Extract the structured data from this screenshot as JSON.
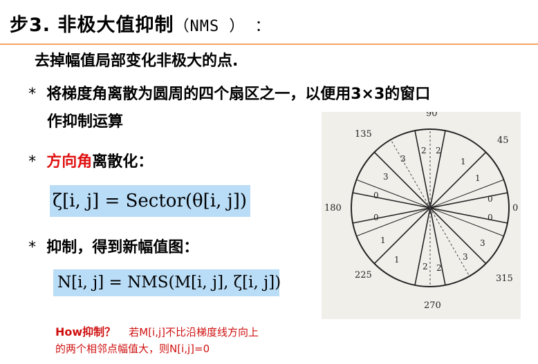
{
  "title": {
    "prefix": "步3. 非极大值抑制",
    "suffix": "（NMS ） ："
  },
  "intro": "去掉幅值局部变化非极大的点.",
  "bullets": {
    "b1_line1": "将梯度角离散为圆周的四个扇区之一，以便用3×3的窗口",
    "b1_line2": "作抑制运算",
    "b2_red": "方向角",
    "b2_rest": "离散化：",
    "b3": "抑制，得到新幅值图："
  },
  "star": "*",
  "formulas": {
    "sector": "ζ[i, j] = Sector(θ[i, j])",
    "nms": "N[i, j] = NMS(M[i, j], ζ[i, j])"
  },
  "diagram": {
    "angles": {
      "a90": "90",
      "a45": "45",
      "a135": "135",
      "a0": "0",
      "a180": "180",
      "a225": "225",
      "a270": "270",
      "a315": "315"
    },
    "sector_labels": [
      "2",
      "2",
      "1",
      "3",
      "3",
      "1",
      "0",
      "0",
      "0",
      "0",
      "1",
      "3",
      "1",
      "3",
      "2",
      "2"
    ]
  },
  "note": {
    "lead": "How抑制？",
    "text1": "若M[i,j]不比沿梯度线方向上",
    "text2": "的两个相邻点幅值大，则N[i,j]=0"
  },
  "colors": {
    "accent_rule": "#f4a460",
    "formula_bg": "#b9dcf7",
    "red": "#e01010"
  }
}
